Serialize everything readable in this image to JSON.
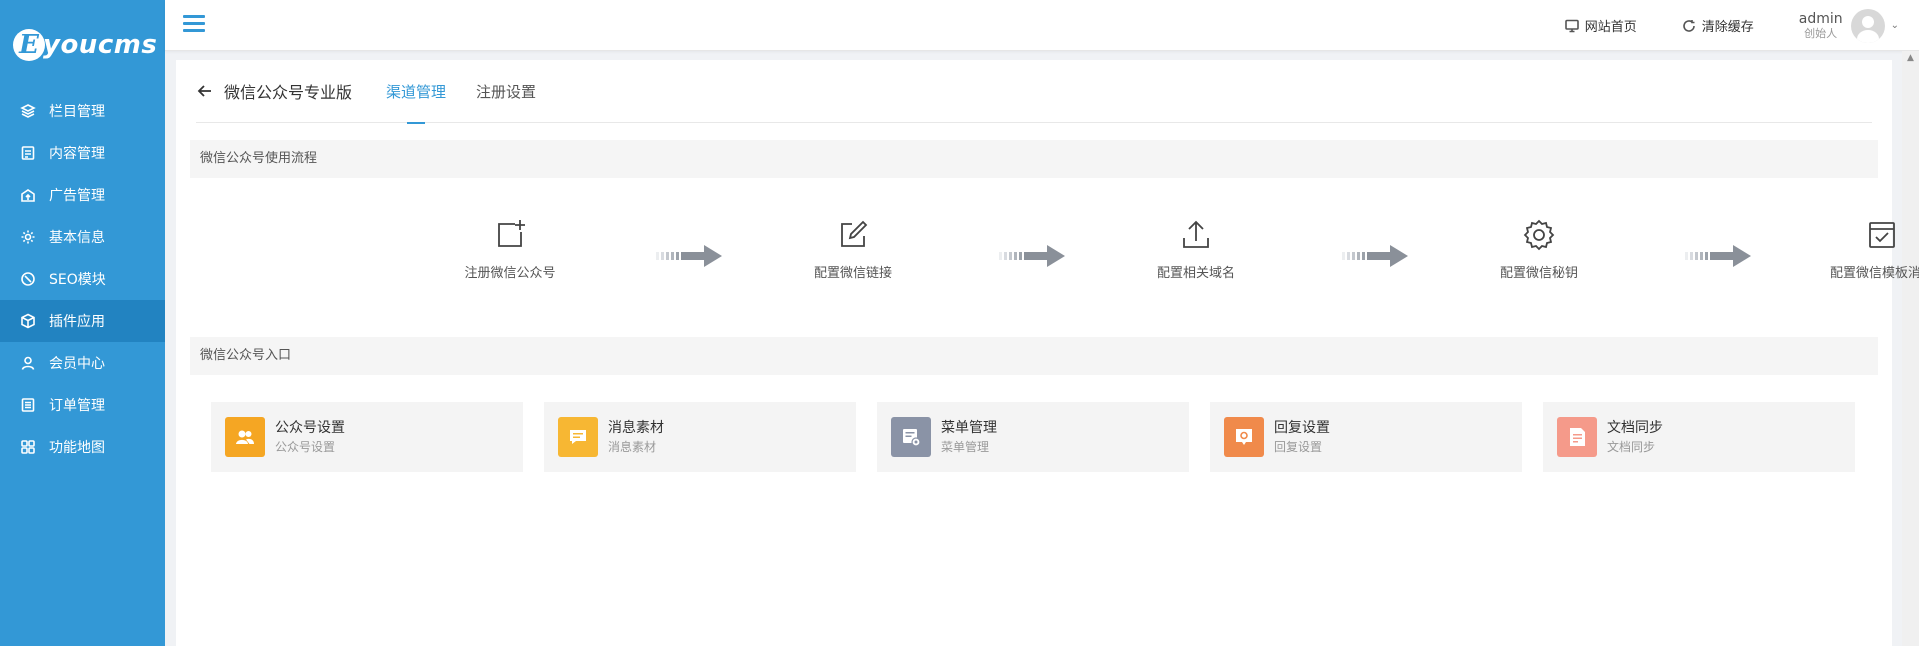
{
  "app": {
    "logo_letter": "E",
    "logo_text": "youcms"
  },
  "sidebar": {
    "items": [
      {
        "label": "栏目管理",
        "icon": "layers-icon"
      },
      {
        "label": "内容管理",
        "icon": "document-icon"
      },
      {
        "label": "广告管理",
        "icon": "ad-icon"
      },
      {
        "label": "基本信息",
        "icon": "gear-icon"
      },
      {
        "label": "SEO模块",
        "icon": "seo-icon"
      },
      {
        "label": "插件应用",
        "icon": "cube-icon",
        "active": true
      },
      {
        "label": "会员中心",
        "icon": "user-icon"
      },
      {
        "label": "订单管理",
        "icon": "list-icon"
      },
      {
        "label": "功能地图",
        "icon": "grid-icon"
      }
    ]
  },
  "topbar": {
    "site_home": "网站首页",
    "clear_cache": "清除缓存",
    "user_name": "admin",
    "user_role": "创始人"
  },
  "tabs": {
    "back_label": "微信公众号专业版",
    "items": [
      "渠道管理",
      "注册设置"
    ],
    "active_index": 0
  },
  "flow": {
    "title": "微信公众号使用流程",
    "steps": [
      {
        "label": "注册微信公众号",
        "icon": "add-square-icon"
      },
      {
        "label": "配置微信链接",
        "icon": "edit-icon"
      },
      {
        "label": "配置相关域名",
        "icon": "upload-icon"
      },
      {
        "label": "配置微信秘钥",
        "icon": "gear-icon"
      },
      {
        "label": "配置微信模板消息",
        "icon": "checkbox-icon"
      }
    ]
  },
  "entry": {
    "title": "微信公众号入口",
    "cards": [
      {
        "title": "公众号设置",
        "sub": "公众号设置",
        "color": "#f5a623",
        "icon": "users-icon"
      },
      {
        "title": "消息素材",
        "sub": "消息素材",
        "color": "#f7b733",
        "icon": "message-icon"
      },
      {
        "title": "菜单管理",
        "sub": "菜单管理",
        "color": "#8a93a6",
        "icon": "menu-settings-icon"
      },
      {
        "title": "回复设置",
        "sub": "回复设置",
        "color": "#f08a4b",
        "icon": "reply-icon"
      },
      {
        "title": "文档同步",
        "sub": "文档同步",
        "color": "#f59a8a",
        "icon": "sync-doc-icon"
      }
    ]
  }
}
